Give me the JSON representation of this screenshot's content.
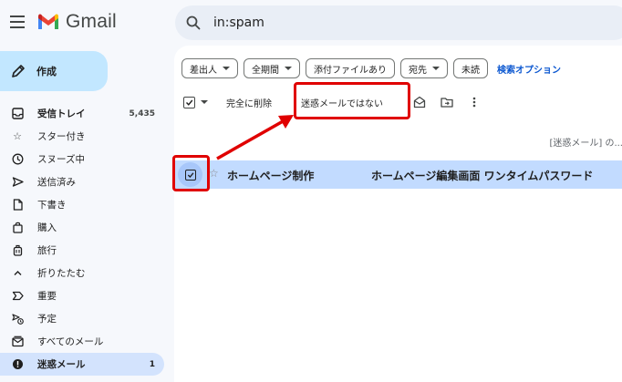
{
  "header": {
    "app_name": "Gmail",
    "search_value": "in:spam"
  },
  "sidebar": {
    "compose_label": "作成",
    "items": [
      {
        "label": "受信トレイ",
        "count": "5,435",
        "icon": "inbox-icon"
      },
      {
        "label": "スター付き",
        "icon": "star-icon"
      },
      {
        "label": "スヌーズ中",
        "icon": "clock-icon"
      },
      {
        "label": "送信済み",
        "icon": "send-icon"
      },
      {
        "label": "下書き",
        "icon": "draft-icon"
      },
      {
        "label": "購入",
        "icon": "shopping-bag-icon"
      },
      {
        "label": "旅行",
        "icon": "luggage-icon"
      },
      {
        "label": "折りたたむ",
        "icon": "chevron-up-icon"
      },
      {
        "label": "重要",
        "icon": "important-icon"
      },
      {
        "label": "予定",
        "icon": "scheduled-icon"
      },
      {
        "label": "すべてのメール",
        "icon": "all-mail-icon"
      },
      {
        "label": "迷惑メール",
        "count": "1",
        "icon": "spam-icon"
      }
    ]
  },
  "filters": {
    "chips": [
      "差出人",
      "全期間",
      "添付ファイルあり",
      "宛先",
      "未読"
    ],
    "advanced_label": "検索オプション"
  },
  "toolbar": {
    "delete_forever_label": "完全に削除",
    "not_spam_label": "迷惑メールではない"
  },
  "info_text": "[迷惑メール] の...",
  "mail": {
    "sender": "ホームページ制作",
    "subject": "ホームページ編集画面 ワンタイムパスワード"
  },
  "colors": {
    "accent": "#0b57d0",
    "annotation": "#e00000",
    "selected_row": "#c2dbff",
    "compose": "#c2e7ff"
  }
}
